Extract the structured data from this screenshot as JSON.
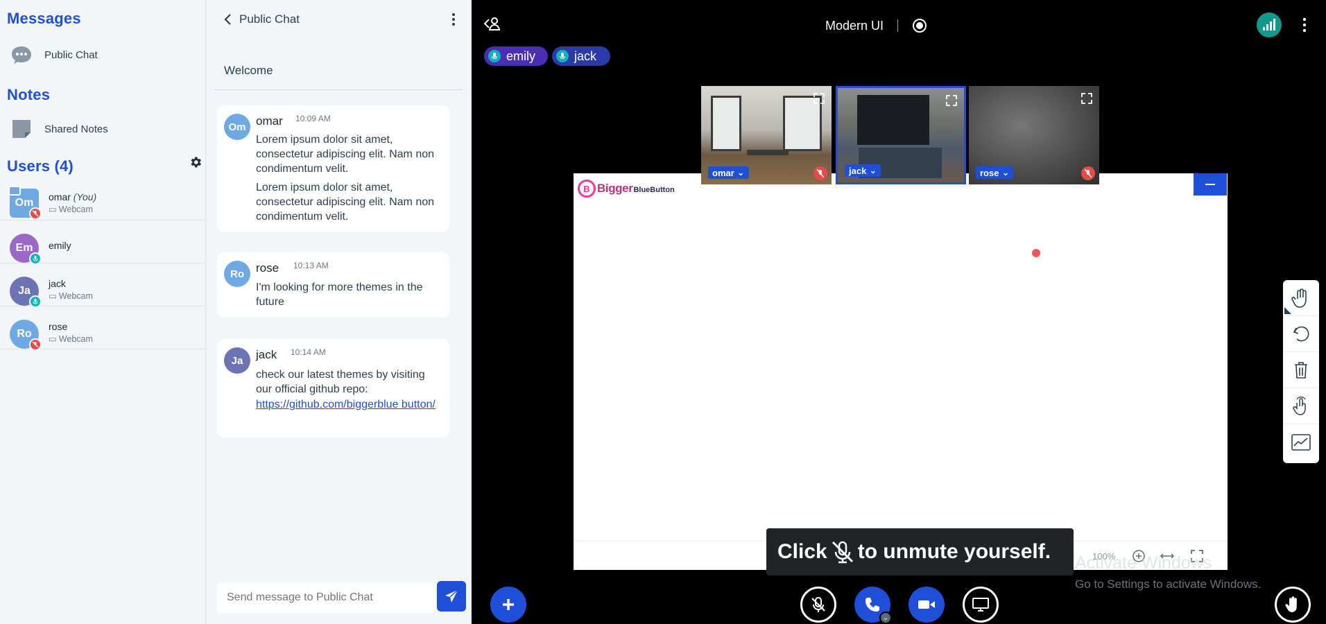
{
  "userlist": {
    "messages_title": "Messages",
    "public_chat_label": "Public Chat",
    "notes_title": "Notes",
    "shared_notes_label": "Shared Notes",
    "users_title": "Users (4)",
    "users": [
      {
        "initials": "Om",
        "name": "omar",
        "you": "(You)",
        "sub": "Webcam",
        "color": "#6ea9e3",
        "badge": "#e84a4a"
      },
      {
        "initials": "Em",
        "name": "emily",
        "you": "",
        "sub": "",
        "color": "#9b68c7",
        "badge": "#11b3bd"
      },
      {
        "initials": "Ja",
        "name": "jack",
        "you": "",
        "sub": "Webcam",
        "color": "#6c74b4",
        "badge": "#11b3bd"
      },
      {
        "initials": "Ro",
        "name": "rose",
        "you": "",
        "sub": "Webcam",
        "color": "#6ea9e3",
        "badge": "#e84a4a"
      }
    ]
  },
  "chat": {
    "title": "Public Chat",
    "welcome": "Welcome",
    "messages": [
      {
        "initials": "Om",
        "name": "omar",
        "time": "10:09 AM",
        "color": "#6ea9e3",
        "lines": [
          "Lorem ipsum dolor sit amet, consectetur adipiscing elit. Nam non condimentum velit.",
          "Lorem ipsum dolor sit amet, consectetur adipiscing elit. Nam non condimentum velit."
        ]
      },
      {
        "initials": "Ro",
        "name": "rose",
        "time": "10:13 AM",
        "color": "#6ea9e3",
        "lines": [
          "I'm looking for more themes in the future"
        ]
      },
      {
        "initials": "Ja",
        "name": "jack",
        "time": "10:14 AM",
        "color": "#6c74b4",
        "lines": [
          "check our latest themes by visiting our official github repo:"
        ],
        "link": "https://github.com/biggerblue button/"
      }
    ],
    "input_placeholder": "Send message to Public Chat"
  },
  "stage": {
    "meeting_title": "Modern UI",
    "talkers": [
      "emily",
      "jack"
    ],
    "videos": [
      {
        "name": "omar",
        "muted": true
      },
      {
        "name": "jack",
        "muted": false
      },
      {
        "name": "rose",
        "muted": true
      }
    ],
    "logo_text_1": "Bigger",
    "logo_text_2": "BlueButton",
    "zoom": "100%",
    "toast_before": "Click",
    "toast_after": "to unmute yourself.",
    "activate_title": "Activate Windows",
    "activate_sub": "Go to Settings to activate Windows."
  },
  "colors": {
    "accent": "#1f4fd8",
    "talk_pill": "#4a2fb5",
    "muted": "#e84a4a",
    "talking": "#11b3bd"
  },
  "icons": [
    "chat-bubble-icon",
    "notes-icon",
    "gear-icon",
    "chevron-left-icon",
    "kebab-icon",
    "send-icon",
    "leave-user-icon",
    "record-icon",
    "signal-icon",
    "expand-icon",
    "mute-icon",
    "hand-icon",
    "undo-icon",
    "trash-icon",
    "multi-user-icon",
    "graph-icon",
    "plus-icon",
    "phone-icon",
    "video-icon",
    "screen-icon",
    "raise-hand-icon"
  ]
}
